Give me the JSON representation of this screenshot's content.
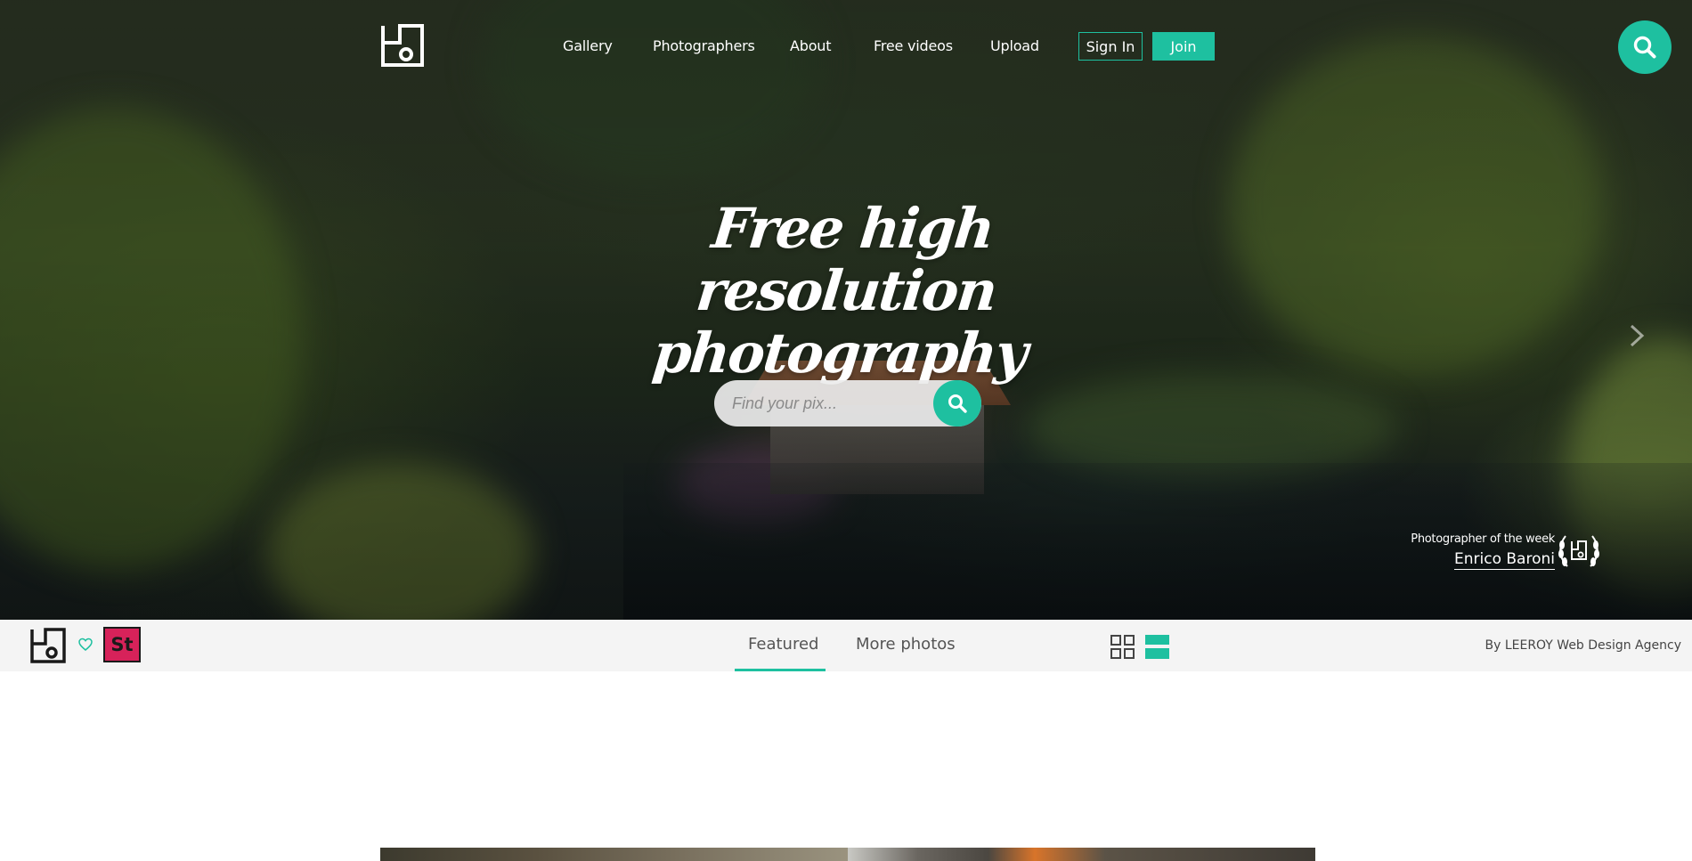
{
  "nav": {
    "links": [
      "Gallery",
      "Photographers",
      "About",
      "Free videos",
      "Upload"
    ],
    "sign_in": "Sign In",
    "join": "Join"
  },
  "hero": {
    "title_line1": "Free high resolution",
    "title_line2": "photography",
    "search_placeholder": "Find your pix...",
    "photographer_label": "Photographer of the week",
    "photographer_name": "Enrico Baroni"
  },
  "toolbar": {
    "stock_label": "St",
    "tabs": [
      "Featured",
      "More photos"
    ],
    "active_tab": "Featured",
    "credit": "By LEEROY Web Design Agency"
  },
  "colors": {
    "accent": "#1ec0a0",
    "stock_brand": "#d7225a",
    "toolbar_bg": "#f4f4f4"
  },
  "icons": {
    "logo": "pixabay-logo-icon",
    "search": "search-icon",
    "heart": "heart-icon",
    "next": "chevron-right-icon",
    "grid_view": "grid-view-icon",
    "list_view": "list-view-icon",
    "badge": "laurel-badge-icon"
  }
}
